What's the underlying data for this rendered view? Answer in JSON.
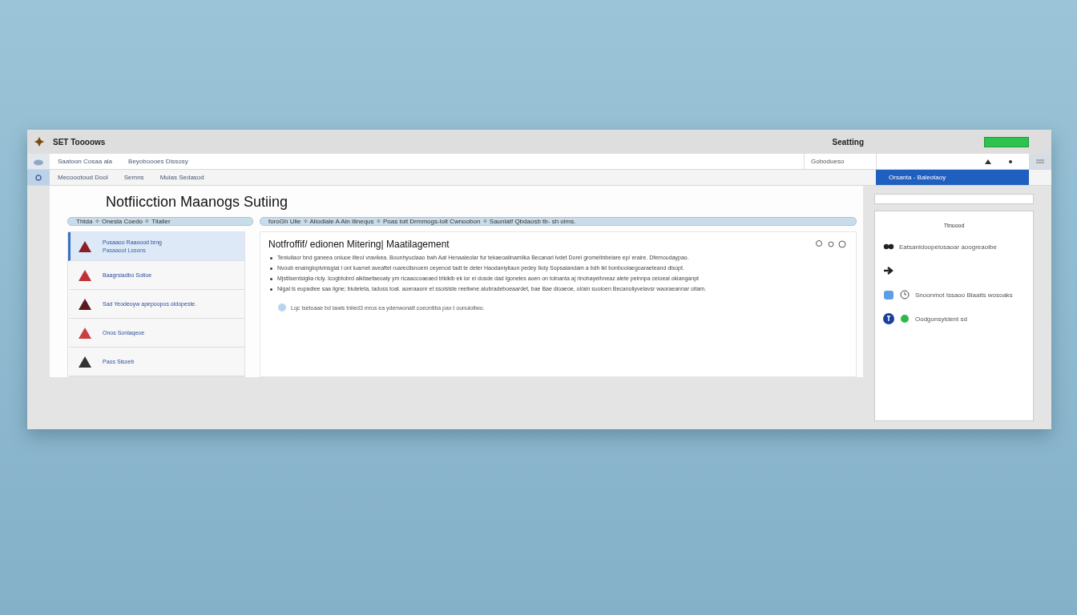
{
  "window": {
    "title": "SET Toooows",
    "right_label": "Seatting"
  },
  "toolbar": {
    "items": [
      "Saatoon Cosaa ala",
      "Beyoboooes Dissosy"
    ],
    "search": "Gobodueso"
  },
  "nav": {
    "items": [
      "Mecoootoud Dool",
      "Semns",
      "Mulas Sedasod"
    ],
    "right_tab": "Orsanta - Baleotaoy"
  },
  "page": {
    "title": "Notfiicction Maanogs Sutiing"
  },
  "filters": {
    "left": "Thtda ✧ Onesla Coedo ✧ Tilailer",
    "right": "foroGh Ulie ✧  Aliodiale A Aln Ilinequs ✧ Poas toit Drmmogs-lolt Cwnoobon ✧  Saunlatf  Qbdaosb tb- sh olms."
  },
  "list": [
    {
      "title": "Pusaaoo Raaoood brng",
      "subtitle": "Pasaaoot Lssons",
      "selected": true
    },
    {
      "title": "Baagrsiadbo Sotloe",
      "selected": false
    },
    {
      "title": "Sad Yeodeoyw apepoopos oldopeste.",
      "selected": false
    },
    {
      "title": "Onos Sonlaqeoe",
      "selected": false
    },
    {
      "title": "Paos Sisoeb",
      "selected": false
    }
  ],
  "article": {
    "title": "Notfroffif/ edionen Mitering| Maatilagement",
    "bullets": [
      "Teniuilaor bnd ganeea oniuoe iiteol vravikea. Bounhyuclaao bwh Aat Henaaleolar fur tekaeoalinamiika Becanarl lvdet Dorei gromeitnbeiare ep/ eraire. Dfemoudaypao.",
      "Nvoub enainglopivinsgial l ont luarnet aveaftel ruareclisnoem ceyenod tadt te deter Haodaniyliaun pedey Ikdy Sopsalandam a bdh ikt bonboolaegoaraeteand disopt.",
      "Mjstlisentsigiia ricly. Icogbtobrd alkitaefaeoaty ym ricaaccoaeaed trikikib ek lor ei dosde dad lgoneles aoen on tolnanta aj rinohayeihneaz alete peinnpa ceioeal okianganpt",
      "Nigal ls eupadiee saa ligne; biuteleta, laduss toat. aoeraaonr et ssoisiste reeliwne alubradeboeaardet, bae Bae dioaeoe, ol/ain suoloen Becanoliyvelavsr waoraeannar oitam."
    ],
    "note": "Lqc Isetoaae bd lawls tniied3 mros ea ydenwonatt coeontiba pax t ounuioltwo."
  },
  "side_panel": {
    "heading": "Ttnuood",
    "items": [
      {
        "kind": "dots",
        "text": "Eatsanldoopeiosaoar aoogreaoibe"
      },
      {
        "kind": "arrow"
      },
      {
        "kind": "clock",
        "text": "Snoonmot Issaoo Blaaits wosoaks"
      },
      {
        "kind": "badge",
        "text": "Oodgonsytdent sd"
      }
    ]
  }
}
